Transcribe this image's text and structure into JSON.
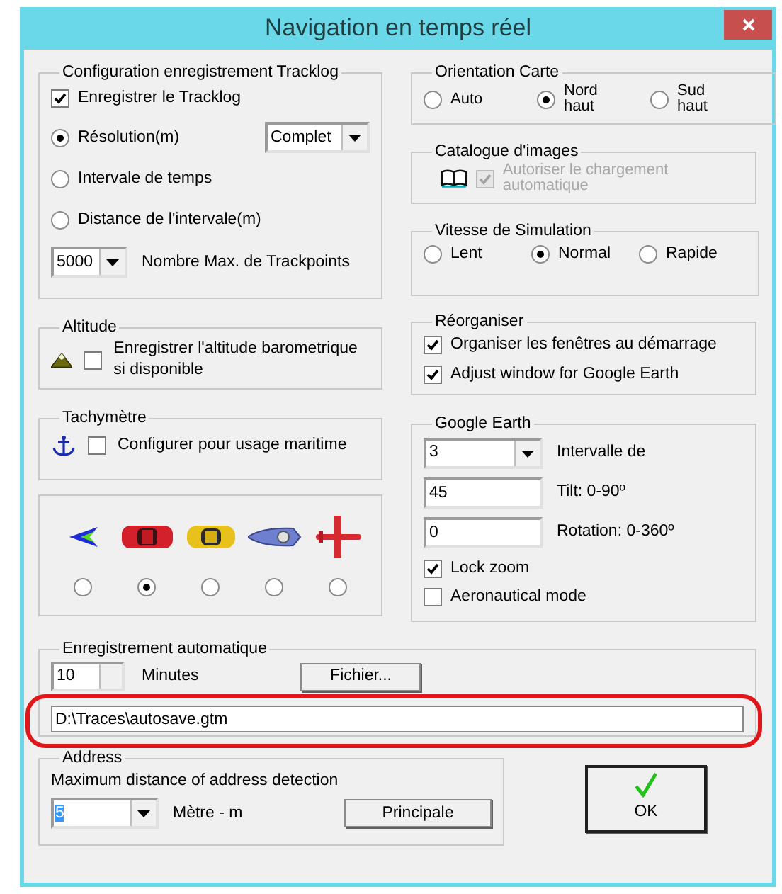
{
  "window": {
    "title": "Navigation en temps réel"
  },
  "tracklog": {
    "title": "Configuration enregistrement Tracklog",
    "record": {
      "label": "Enregistrer le Tracklog",
      "checked": true
    },
    "modes": [
      {
        "label": "Résolution(m)",
        "selected": true
      },
      {
        "label": "Intervale de temps",
        "selected": false
      },
      {
        "label": "Distance de l'intervale(m)",
        "selected": false
      }
    ],
    "resolution_select": "Complet",
    "max_select": "5000",
    "max_label": "Nombre Max. de Trackpoints"
  },
  "orientation": {
    "title": "Orientation Carte",
    "options": [
      {
        "label": "Auto",
        "selected": false
      },
      {
        "label": "Nord haut",
        "selected": true
      },
      {
        "label": "Sud haut",
        "selected": false
      }
    ]
  },
  "catalogue": {
    "title": "Catalogue d'images",
    "autoload": {
      "label": "Autoriser le chargement automatique",
      "checked": true,
      "disabled": true
    }
  },
  "simulation": {
    "title": "Vitesse de Simulation",
    "options": [
      {
        "label": "Lent",
        "selected": false
      },
      {
        "label": "Normal",
        "selected": true
      },
      {
        "label": "Rapide",
        "selected": false
      }
    ]
  },
  "altitude": {
    "title": "Altitude",
    "record": {
      "label": "Enregistrer l'altitude barometrique si disponible",
      "checked": false
    }
  },
  "reorganiser": {
    "title": "Réorganiser",
    "options": [
      {
        "label": "Organiser les fenêtres au démarrage",
        "checked": true
      },
      {
        "label": "Adjust window for Google Earth",
        "checked": true
      }
    ]
  },
  "tachymetre": {
    "title": "Tachymètre",
    "maritime": {
      "label": "Configurer pour usage maritime",
      "checked": false
    }
  },
  "vehicles": [
    {
      "kind": "arrow",
      "selected": false
    },
    {
      "kind": "red_car",
      "selected": true
    },
    {
      "kind": "yellow_car",
      "selected": false
    },
    {
      "kind": "boat",
      "selected": false
    },
    {
      "kind": "plane",
      "selected": false
    }
  ],
  "google_earth": {
    "title": "Google Earth",
    "refresh": {
      "value": "3",
      "label": "Intervalle de"
    },
    "tilt": {
      "value": "45",
      "label": "Tilt: 0-90º"
    },
    "rotation": {
      "value": "0",
      "label": "Rotation:  0-360º"
    },
    "options": [
      {
        "label": "Lock zoom",
        "checked": true
      },
      {
        "label": "Aeronautical mode",
        "checked": false
      }
    ]
  },
  "autosave": {
    "title": "Enregistrement automatique",
    "minutes_value": "10",
    "minutes_label": "Minutes",
    "file_button": "Fichier...",
    "path": "D:\\Traces\\autosave.gtm"
  },
  "address": {
    "title": "Address",
    "label": "Maximum distance of address detection",
    "value": "5",
    "unit": "Mètre - m",
    "button": "Principale"
  },
  "ok_button": "OK"
}
